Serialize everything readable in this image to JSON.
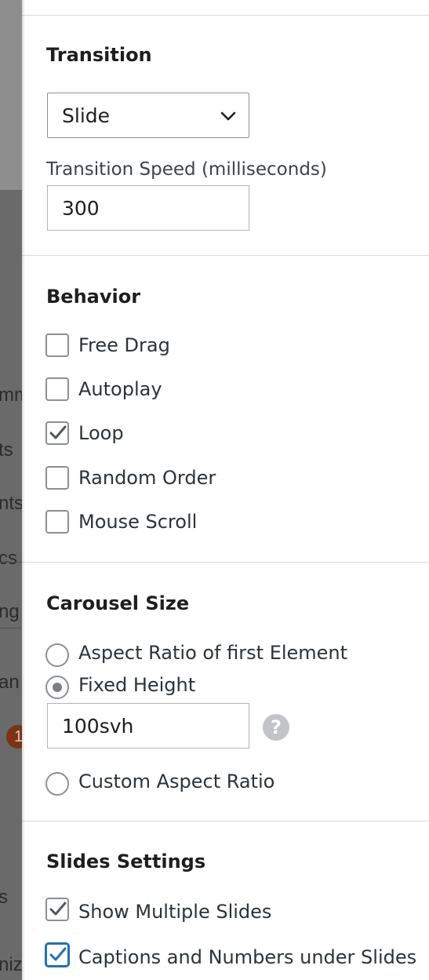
{
  "background": {
    "fragments": [
      "mm",
      "ts",
      "nts",
      "cs",
      "ng",
      "an",
      "s",
      "nize"
    ],
    "badge": "1"
  },
  "transition": {
    "title": "Transition",
    "select_value": "Slide",
    "speed_label": "Transition Speed (milliseconds)",
    "speed_value": "300"
  },
  "behavior": {
    "title": "Behavior",
    "options": [
      {
        "label": "Free Drag",
        "checked": false
      },
      {
        "label": "Autoplay",
        "checked": false
      },
      {
        "label": "Loop",
        "checked": true
      },
      {
        "label": "Random Order",
        "checked": false
      },
      {
        "label": "Mouse Scroll",
        "checked": false
      }
    ]
  },
  "carousel_size": {
    "title": "Carousel Size",
    "options": [
      {
        "label": "Aspect Ratio of first Element",
        "selected": false
      },
      {
        "label": "Fixed Height",
        "selected": true
      },
      {
        "label": "Custom Aspect Ratio",
        "selected": false
      }
    ],
    "height_value": "100svh",
    "help_symbol": "?"
  },
  "slides_settings": {
    "title": "Slides Settings",
    "options": [
      {
        "label": "Show Multiple Slides",
        "checked": true
      },
      {
        "label": "Captions and Numbers under Slides",
        "checked": true
      }
    ]
  },
  "colors": {
    "accent": "#2271b1",
    "checkbox_border": "#8c8f94",
    "divider": "#dcdcde"
  }
}
